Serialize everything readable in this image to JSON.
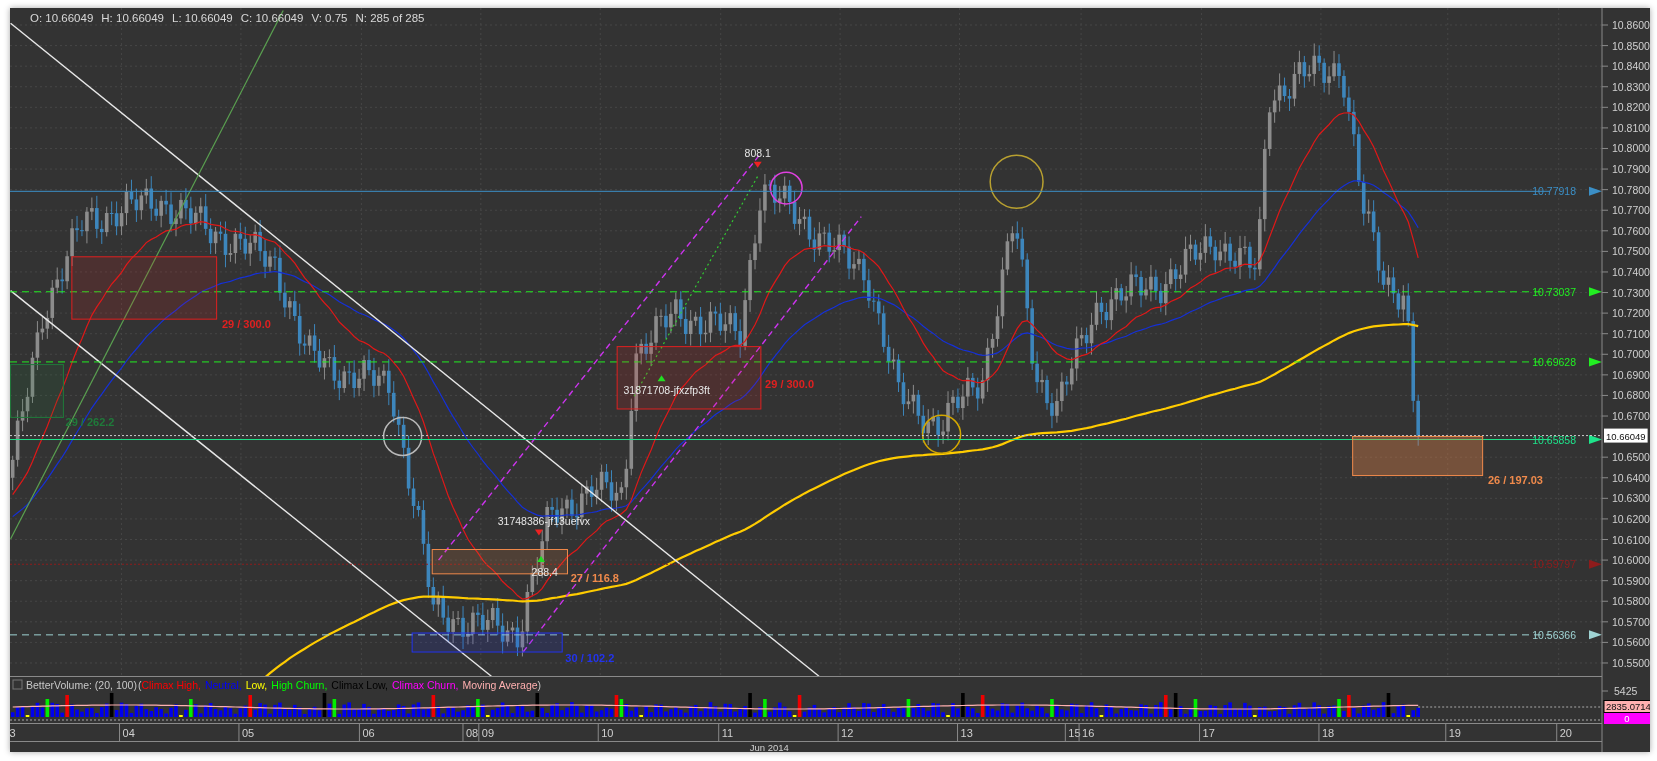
{
  "header": [
    "O: 10.66049",
    "H: 10.66049",
    "L: 10.66049",
    "C: 10.66049",
    "V: 0.75",
    "N: 285 of 285"
  ],
  "price_axis": {
    "ticks": [
      "10.8600",
      "10.8500",
      "10.8400",
      "10.8300",
      "10.8200",
      "10.8100",
      "10.8000",
      "10.7900",
      "10.7800",
      "10.7700",
      "10.7600",
      "10.7500",
      "10.7400",
      "10.7300",
      "10.7200",
      "10.7100",
      "10.7000",
      "10.6900",
      "10.6800",
      "10.6700",
      "10.6500",
      "10.6400",
      "10.6300",
      "10.6200",
      "10.6100",
      "10.6000",
      "10.5900",
      "10.5800",
      "10.5700",
      "10.5600",
      "10.5500"
    ],
    "current_price": "10.66049"
  },
  "level_lines": [
    {
      "label": "10.77918",
      "color": "#3b8fc6",
      "kind": "solid"
    },
    {
      "label": "10.73037",
      "color": "#22ee22",
      "kind": "dashed"
    },
    {
      "label": "10.69628",
      "color": "#22ee22",
      "kind": "dashed"
    },
    {
      "label": "10.65858",
      "color": "#1ee38a",
      "kind": "solid"
    },
    {
      "label": "10.59797",
      "color": "#8e1c1c",
      "kind": "dotted"
    },
    {
      "label": "10.56366",
      "color": "#9fd3d3",
      "kind": "dashed"
    }
  ],
  "annotations": [
    {
      "kind": "box",
      "label": "29 / 262.2",
      "color": "#1f7a3a"
    },
    {
      "kind": "box",
      "label": "29 / 300.0",
      "color": "#e02020"
    },
    {
      "kind": "box",
      "label": "29 / 300.0",
      "color": "#e02020"
    },
    {
      "kind": "box",
      "label": "27 / 116.8",
      "color": "#f08a4b"
    },
    {
      "kind": "box",
      "label": "30 / 102.2",
      "color": "#2233ee"
    },
    {
      "kind": "box",
      "label": "26 / 197.03",
      "color": "#f08a4b"
    },
    {
      "kind": "downtag",
      "label": "808.1"
    },
    {
      "kind": "uptag",
      "label": "31871708-jfxzfp3ft"
    },
    {
      "kind": "downtag",
      "label": "31748386-jf13uefvx"
    },
    {
      "kind": "uptag",
      "label": "288.4"
    }
  ],
  "volume": {
    "legend": {
      "title": "BetterVolume: (20, 100)",
      "open": "(",
      "close": ")",
      "items": [
        {
          "label": "Climax High,",
          "color": "#ff0000"
        },
        {
          "label": "Neutral,",
          "color": "#0000ff"
        },
        {
          "label": "Low,",
          "color": "#ffff00"
        },
        {
          "label": "High Churn,",
          "color": "#00ff00"
        },
        {
          "label": "Climax Low,",
          "color": "#000000"
        },
        {
          "label": "Climax Churn,",
          "color": "#ff00ff"
        },
        {
          "label": "Moving Average",
          "color": "#ffb0b0"
        }
      ]
    },
    "axis_label": "5425",
    "average_badge": "2835.0714",
    "current_badge": "0"
  },
  "x_axis": {
    "labels": [
      "3",
      "04",
      "05",
      "06",
      "08",
      "09",
      "10",
      "11",
      "12",
      "13",
      "15",
      "16",
      "17",
      "18",
      "19",
      "20"
    ],
    "month": "Jun 2014"
  }
}
